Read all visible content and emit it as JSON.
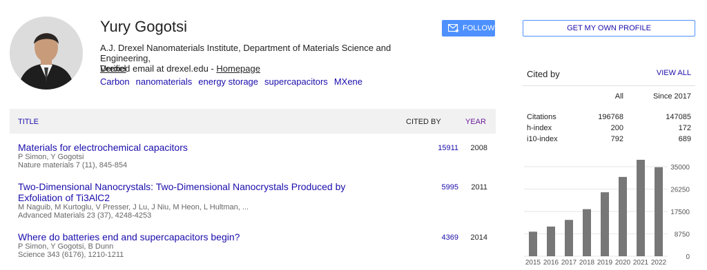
{
  "profile": {
    "name": "Yury Gogotsi",
    "affiliation_line": "A.J. Drexel Nanomaterials Institute, Department of Materials Science and Engineering,",
    "affiliation_link": "Drexel",
    "email_text": "Verified email at drexel.edu - ",
    "homepage_label": "Homepage",
    "interests": [
      "Carbon",
      "nanomaterials",
      "energy storage",
      "supercapacitors",
      "MXene"
    ],
    "follow_label": "FOLLOW"
  },
  "table": {
    "title_header": "TITLE",
    "cited_header": "CITED BY",
    "year_header": "YEAR",
    "papers": [
      {
        "title": "Materials for electrochemical capacitors",
        "authors": "P Simon, Y Gogotsi",
        "venue": "Nature materials 7 (11), 845-854",
        "cited": "15911",
        "year": "2008"
      },
      {
        "title": "Two-Dimensional Nanocrystals: Two-Dimensional Nanocrystals Produced by Exfoliation of Ti3AlC2",
        "authors": "M Naguib, M Kurtoglu, V Presser, J Lu, J Niu, M Heon, L Hultman, ...",
        "venue": "Advanced Materials 23 (37), 4248-4253",
        "cited": "5995",
        "year": "2011"
      },
      {
        "title": "Where do batteries end and supercapacitors begin?",
        "authors": "P Simon, Y Gogotsi, B Dunn",
        "venue": "Science 343 (6176), 1210-1211",
        "cited": "4369",
        "year": "2014"
      }
    ]
  },
  "sidebar": {
    "own_profile_label": "GET MY OWN PROFILE",
    "cited_by_title": "Cited by",
    "view_all_label": "VIEW ALL",
    "col_all": "All",
    "col_since": "Since 2017",
    "metrics": [
      {
        "label": "Citations",
        "all": "196768",
        "since": "147085"
      },
      {
        "label": "h-index",
        "all": "200",
        "since": "172"
      },
      {
        "label": "i10-index",
        "all": "792",
        "since": "689"
      }
    ]
  },
  "colors": {
    "link": "#1a0dab",
    "follow_button": "#4d90fe",
    "bar": "#777777",
    "year_header": "#6a1b9a"
  },
  "chart_data": {
    "type": "bar",
    "categories": [
      "2015",
      "2016",
      "2017",
      "2018",
      "2019",
      "2020",
      "2021",
      "2022"
    ],
    "values": [
      9600,
      11600,
      14200,
      18400,
      25000,
      31000,
      38300,
      34800
    ],
    "ylim": [
      0,
      35000
    ],
    "yticks": [
      "35000",
      "26250",
      "17500",
      "8750",
      "0"
    ],
    "grid": true
  }
}
